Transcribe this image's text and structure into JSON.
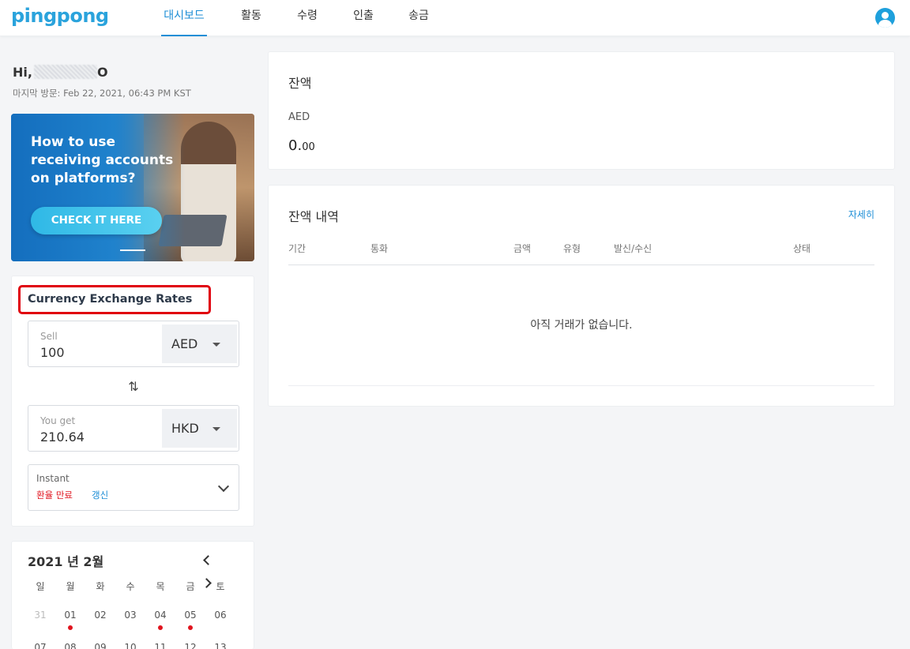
{
  "brand": {
    "logo": "pingpong"
  },
  "nav": {
    "tabs": [
      {
        "label": "대시보드",
        "active": true
      },
      {
        "label": "활동",
        "active": false
      },
      {
        "label": "수령",
        "active": false
      },
      {
        "label": "인출",
        "active": false
      },
      {
        "label": "송금",
        "active": false
      }
    ]
  },
  "user": {
    "greeting_prefix": "Hi,",
    "greeting_suffix": "O",
    "last_visit": "마지막 방문: Feb 22, 2021, 06:43 PM KST"
  },
  "banner": {
    "headline": "How to use receiving accounts on platforms?",
    "button": "CHECK IT HERE"
  },
  "fx": {
    "title": "Currency Exchange Rates",
    "sell_label": "Sell",
    "sell_value": "100",
    "sell_currency": "AED",
    "get_label": "You get",
    "get_value": "210.64",
    "get_currency": "HKD",
    "instant_label": "Instant",
    "expired_label": "환율 만료",
    "refresh_label": "갱신"
  },
  "calendar": {
    "title": "2021 년 2월",
    "weekdays": [
      "일",
      "월",
      "화",
      "수",
      "목",
      "금",
      "토"
    ],
    "row1": [
      "31",
      "01",
      "02",
      "03",
      "04",
      "05",
      "06"
    ],
    "row2": [
      "07",
      "08",
      "09",
      "10",
      "11",
      "12",
      "13"
    ],
    "dotted_days": [
      "01",
      "04",
      "05"
    ]
  },
  "balance": {
    "title": "잔액",
    "currency": "AED",
    "amount_int": "0.",
    "amount_dec": "00"
  },
  "history": {
    "title": "잔액 내역",
    "more": "자세히",
    "columns": [
      "기간",
      "통화",
      "금액",
      "유형",
      "발신/수신",
      "상태"
    ],
    "empty": "아직 거래가 없습니다."
  },
  "colors": {
    "accent": "#1d8ed6",
    "highlight_box": "#e0000d",
    "alert": "#e0141e"
  },
  "icons": [
    "user-avatar-icon",
    "caret-down-icon",
    "swap-arrows-icon",
    "chevron-down-icon",
    "chevron-left-icon",
    "chevron-right-icon"
  ]
}
